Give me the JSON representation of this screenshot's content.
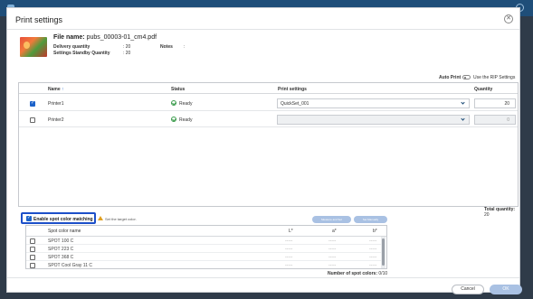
{
  "dialog": {
    "title": "Print settings"
  },
  "job": {
    "file_name_label": "File name:",
    "file_name": "pubs_00003-01_cm4.pdf",
    "delivery_quantity_label": "Delivery quantity",
    "delivery_quantity_value": ": 20",
    "standby_label": "Settings Standby Quantity",
    "standby_value": ": 20",
    "notes_label": "Notes",
    "notes_value": ":"
  },
  "auto_print": {
    "label": "Auto Print",
    "option_text": "Use the RIP Settings"
  },
  "printer_table": {
    "headers": {
      "name": "Name",
      "sort_indicator": "↑",
      "status": "Status",
      "print_settings": "Print settings",
      "quantity": "Quantity"
    },
    "rows": [
      {
        "name": "Printer1",
        "status": "Ready",
        "print_setting": "QuickSet_001",
        "quantity": "20",
        "checked": true
      },
      {
        "name": "Printer2",
        "status": "Ready",
        "print_setting": "",
        "quantity": "0",
        "checked": false
      }
    ]
  },
  "total_quantity": {
    "label": "Total quantity:",
    "value": "20"
  },
  "spot": {
    "enable_label": "Enable spot color matching",
    "warning_text": "Set the target color.",
    "measure_button": "Measure and Set",
    "set_manually_button": "Set Manually",
    "headers": {
      "name": "Spot color name",
      "l": "L*",
      "a": "a*",
      "b": "b*"
    },
    "rows": [
      {
        "name": "SPOT 100 C",
        "l": "-----",
        "a": "-----",
        "b": "-----"
      },
      {
        "name": "SPOT 223 C",
        "l": "-----",
        "a": "-----",
        "b": "-----"
      },
      {
        "name": "SPOT 368 C",
        "l": "-----",
        "a": "-----",
        "b": "-----"
      },
      {
        "name": "SPOT Cool Gray 11 C",
        "l": "-----",
        "a": "-----",
        "b": "-----"
      }
    ],
    "count_label": "Number of spot colors:",
    "count_value": "0/10"
  },
  "footer": {
    "cancel": "Cancel",
    "ok": "OK"
  },
  "colors": {
    "accent": "#1c62c9",
    "highlight_border": "#1c4fc9",
    "disabled_button": "#a9c1e3",
    "ready_green": "#3a9b4b"
  }
}
